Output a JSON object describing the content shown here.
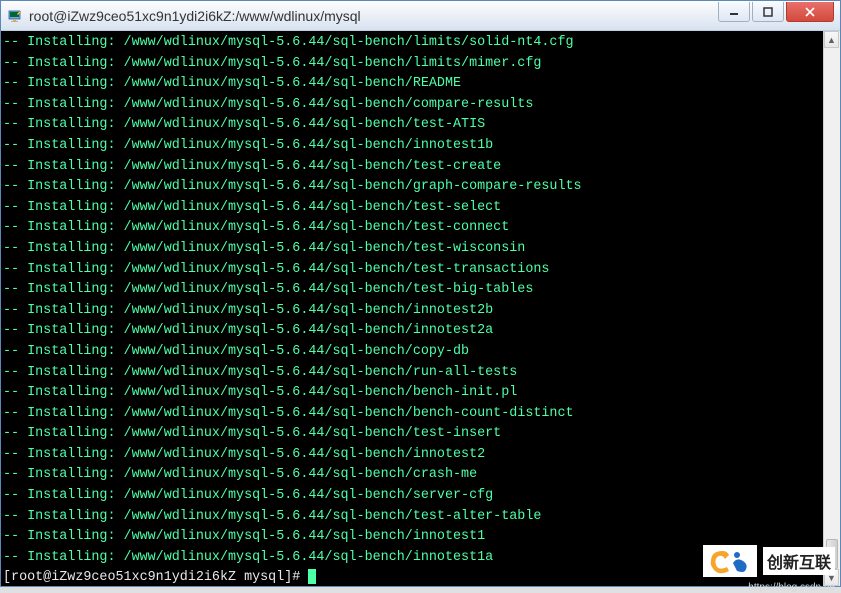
{
  "window": {
    "title": "root@iZwz9ceo51xc9n1ydi2i6kZ:/www/wdlinux/mysql"
  },
  "terminal": {
    "install_prefix": "-- Installing: ",
    "base_path": "/www/wdlinux/mysql-5.6.44/sql-bench/",
    "files": [
      "limits/solid-nt4.cfg",
      "limits/mimer.cfg",
      "README",
      "compare-results",
      "test-ATIS",
      "innotest1b",
      "test-create",
      "graph-compare-results",
      "test-select",
      "test-connect",
      "test-wisconsin",
      "test-transactions",
      "test-big-tables",
      "innotest2b",
      "innotest2a",
      "copy-db",
      "run-all-tests",
      "bench-init.pl",
      "bench-count-distinct",
      "test-insert",
      "innotest2",
      "crash-me",
      "server-cfg",
      "test-alter-table",
      "innotest1",
      "innotest1a"
    ],
    "prompt_user": "root@iZwz9ceo51xc9n1ydi2i6kZ",
    "prompt_dir": "mysql",
    "prompt_suffix": "#"
  },
  "watermark": {
    "brand": "创新互联",
    "url": "https://blog.csdn.ne"
  }
}
